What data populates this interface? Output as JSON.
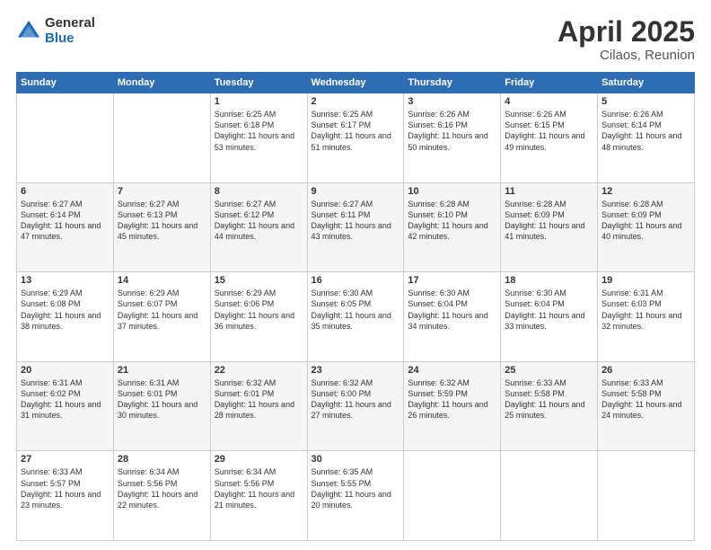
{
  "logo": {
    "general": "General",
    "blue": "Blue"
  },
  "header": {
    "month": "April 2025",
    "location": "Cilaos, Reunion"
  },
  "weekdays": [
    "Sunday",
    "Monday",
    "Tuesday",
    "Wednesday",
    "Thursday",
    "Friday",
    "Saturday"
  ],
  "weeks": [
    [
      {
        "day": "",
        "sunrise": "",
        "sunset": "",
        "daylight": ""
      },
      {
        "day": "",
        "sunrise": "",
        "sunset": "",
        "daylight": ""
      },
      {
        "day": "1",
        "sunrise": "Sunrise: 6:25 AM",
        "sunset": "Sunset: 6:18 PM",
        "daylight": "Daylight: 11 hours and 53 minutes."
      },
      {
        "day": "2",
        "sunrise": "Sunrise: 6:25 AM",
        "sunset": "Sunset: 6:17 PM",
        "daylight": "Daylight: 11 hours and 51 minutes."
      },
      {
        "day": "3",
        "sunrise": "Sunrise: 6:26 AM",
        "sunset": "Sunset: 6:16 PM",
        "daylight": "Daylight: 11 hours and 50 minutes."
      },
      {
        "day": "4",
        "sunrise": "Sunrise: 6:26 AM",
        "sunset": "Sunset: 6:15 PM",
        "daylight": "Daylight: 11 hours and 49 minutes."
      },
      {
        "day": "5",
        "sunrise": "Sunrise: 6:26 AM",
        "sunset": "Sunset: 6:14 PM",
        "daylight": "Daylight: 11 hours and 48 minutes."
      }
    ],
    [
      {
        "day": "6",
        "sunrise": "Sunrise: 6:27 AM",
        "sunset": "Sunset: 6:14 PM",
        "daylight": "Daylight: 11 hours and 47 minutes."
      },
      {
        "day": "7",
        "sunrise": "Sunrise: 6:27 AM",
        "sunset": "Sunset: 6:13 PM",
        "daylight": "Daylight: 11 hours and 45 minutes."
      },
      {
        "day": "8",
        "sunrise": "Sunrise: 6:27 AM",
        "sunset": "Sunset: 6:12 PM",
        "daylight": "Daylight: 11 hours and 44 minutes."
      },
      {
        "day": "9",
        "sunrise": "Sunrise: 6:27 AM",
        "sunset": "Sunset: 6:11 PM",
        "daylight": "Daylight: 11 hours and 43 minutes."
      },
      {
        "day": "10",
        "sunrise": "Sunrise: 6:28 AM",
        "sunset": "Sunset: 6:10 PM",
        "daylight": "Daylight: 11 hours and 42 minutes."
      },
      {
        "day": "11",
        "sunrise": "Sunrise: 6:28 AM",
        "sunset": "Sunset: 6:09 PM",
        "daylight": "Daylight: 11 hours and 41 minutes."
      },
      {
        "day": "12",
        "sunrise": "Sunrise: 6:28 AM",
        "sunset": "Sunset: 6:09 PM",
        "daylight": "Daylight: 11 hours and 40 minutes."
      }
    ],
    [
      {
        "day": "13",
        "sunrise": "Sunrise: 6:29 AM",
        "sunset": "Sunset: 6:08 PM",
        "daylight": "Daylight: 11 hours and 38 minutes."
      },
      {
        "day": "14",
        "sunrise": "Sunrise: 6:29 AM",
        "sunset": "Sunset: 6:07 PM",
        "daylight": "Daylight: 11 hours and 37 minutes."
      },
      {
        "day": "15",
        "sunrise": "Sunrise: 6:29 AM",
        "sunset": "Sunset: 6:06 PM",
        "daylight": "Daylight: 11 hours and 36 minutes."
      },
      {
        "day": "16",
        "sunrise": "Sunrise: 6:30 AM",
        "sunset": "Sunset: 6:05 PM",
        "daylight": "Daylight: 11 hours and 35 minutes."
      },
      {
        "day": "17",
        "sunrise": "Sunrise: 6:30 AM",
        "sunset": "Sunset: 6:04 PM",
        "daylight": "Daylight: 11 hours and 34 minutes."
      },
      {
        "day": "18",
        "sunrise": "Sunrise: 6:30 AM",
        "sunset": "Sunset: 6:04 PM",
        "daylight": "Daylight: 11 hours and 33 minutes."
      },
      {
        "day": "19",
        "sunrise": "Sunrise: 6:31 AM",
        "sunset": "Sunset: 6:03 PM",
        "daylight": "Daylight: 11 hours and 32 minutes."
      }
    ],
    [
      {
        "day": "20",
        "sunrise": "Sunrise: 6:31 AM",
        "sunset": "Sunset: 6:02 PM",
        "daylight": "Daylight: 11 hours and 31 minutes."
      },
      {
        "day": "21",
        "sunrise": "Sunrise: 6:31 AM",
        "sunset": "Sunset: 6:01 PM",
        "daylight": "Daylight: 11 hours and 30 minutes."
      },
      {
        "day": "22",
        "sunrise": "Sunrise: 6:32 AM",
        "sunset": "Sunset: 6:01 PM",
        "daylight": "Daylight: 11 hours and 28 minutes."
      },
      {
        "day": "23",
        "sunrise": "Sunrise: 6:32 AM",
        "sunset": "Sunset: 6:00 PM",
        "daylight": "Daylight: 11 hours and 27 minutes."
      },
      {
        "day": "24",
        "sunrise": "Sunrise: 6:32 AM",
        "sunset": "Sunset: 5:59 PM",
        "daylight": "Daylight: 11 hours and 26 minutes."
      },
      {
        "day": "25",
        "sunrise": "Sunrise: 6:33 AM",
        "sunset": "Sunset: 5:58 PM",
        "daylight": "Daylight: 11 hours and 25 minutes."
      },
      {
        "day": "26",
        "sunrise": "Sunrise: 6:33 AM",
        "sunset": "Sunset: 5:58 PM",
        "daylight": "Daylight: 11 hours and 24 minutes."
      }
    ],
    [
      {
        "day": "27",
        "sunrise": "Sunrise: 6:33 AM",
        "sunset": "Sunset: 5:57 PM",
        "daylight": "Daylight: 11 hours and 23 minutes."
      },
      {
        "day": "28",
        "sunrise": "Sunrise: 6:34 AM",
        "sunset": "Sunset: 5:56 PM",
        "daylight": "Daylight: 11 hours and 22 minutes."
      },
      {
        "day": "29",
        "sunrise": "Sunrise: 6:34 AM",
        "sunset": "Sunset: 5:56 PM",
        "daylight": "Daylight: 11 hours and 21 minutes."
      },
      {
        "day": "30",
        "sunrise": "Sunrise: 6:35 AM",
        "sunset": "Sunset: 5:55 PM",
        "daylight": "Daylight: 11 hours and 20 minutes."
      },
      {
        "day": "",
        "sunrise": "",
        "sunset": "",
        "daylight": ""
      },
      {
        "day": "",
        "sunrise": "",
        "sunset": "",
        "daylight": ""
      },
      {
        "day": "",
        "sunrise": "",
        "sunset": "",
        "daylight": ""
      }
    ]
  ]
}
